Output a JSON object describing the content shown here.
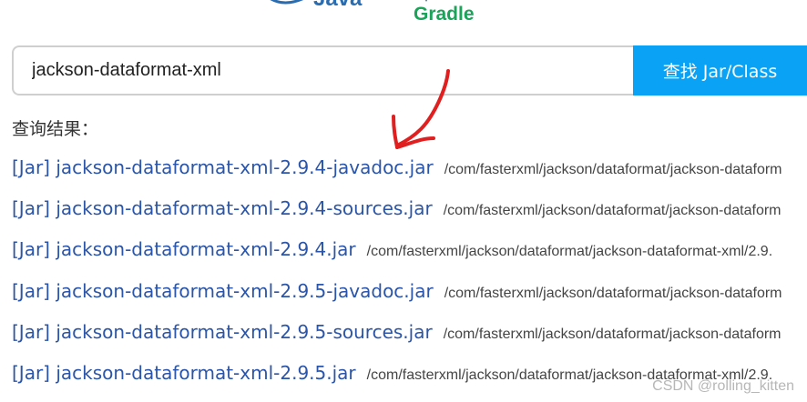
{
  "logos": {
    "java_text": "Java",
    "gradle_text": "Gradle"
  },
  "search": {
    "value": "jackson-dataformat-xml",
    "button_label": "查找 Jar/Class"
  },
  "results": {
    "label": "查询结果：",
    "items": [
      {
        "name": "[Jar] jackson-dataformat-xml-2.9.4-javadoc.jar",
        "path": "/com/fasterxml/jackson/dataformat/jackson-dataform"
      },
      {
        "name": "[Jar] jackson-dataformat-xml-2.9.4-sources.jar",
        "path": "/com/fasterxml/jackson/dataformat/jackson-dataform"
      },
      {
        "name": "[Jar] jackson-dataformat-xml-2.9.4.jar",
        "path": "/com/fasterxml/jackson/dataformat/jackson-dataformat-xml/2.9."
      },
      {
        "name": "[Jar] jackson-dataformat-xml-2.9.5-javadoc.jar",
        "path": "/com/fasterxml/jackson/dataformat/jackson-dataform"
      },
      {
        "name": "[Jar] jackson-dataformat-xml-2.9.5-sources.jar",
        "path": "/com/fasterxml/jackson/dataformat/jackson-dataform"
      },
      {
        "name": "[Jar] jackson-dataformat-xml-2.9.5.jar",
        "path": "/com/fasterxml/jackson/dataformat/jackson-dataformat-xml/2.9."
      }
    ]
  },
  "annotation": {
    "arrow_color": "#e02020"
  },
  "watermark": "CSDN @rolling_kitten",
  "colors": {
    "accent": "#0aa2f5",
    "link": "#2a55a8"
  }
}
